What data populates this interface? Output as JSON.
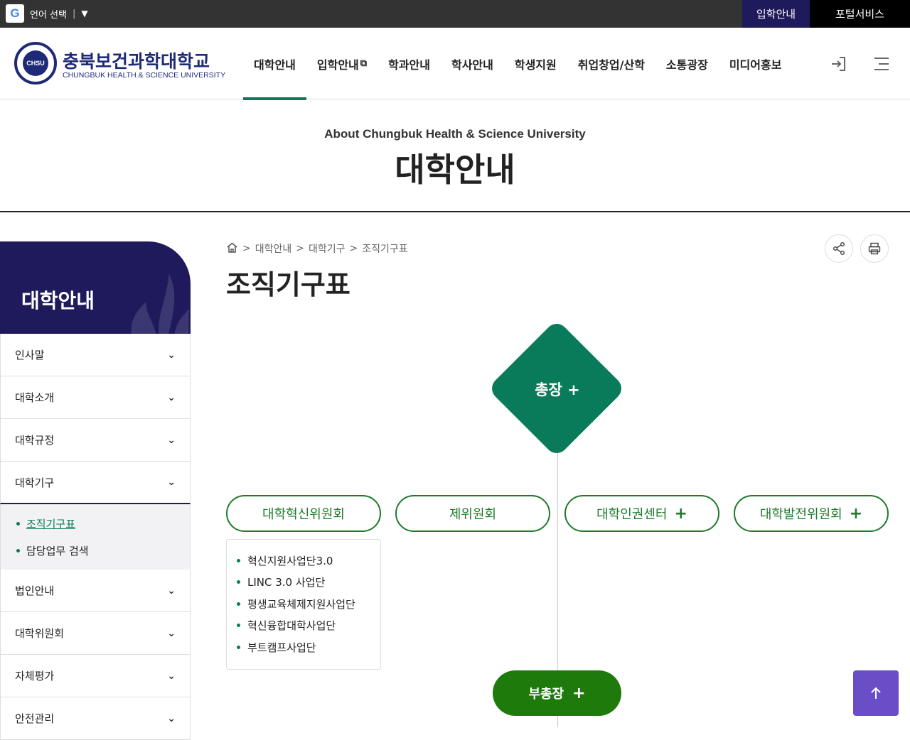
{
  "topbar": {
    "google_glyph": "G",
    "language_label": "언어 선택",
    "language_sep": "|",
    "language_arrow": "▼",
    "admission_label": "입학안내",
    "portal_label": "포털서비스"
  },
  "header": {
    "logo_ko": "충북보건과학대학교",
    "logo_en": "CHUNGBUK HEALTH & SCIENCE UNIVERSITY",
    "emblem_text": "CHSU",
    "nav": [
      {
        "label": "대학안내",
        "active": true
      },
      {
        "label": "입학안내",
        "external": true
      },
      {
        "label": "학과안내"
      },
      {
        "label": "학사안내"
      },
      {
        "label": "학생지원"
      },
      {
        "label": "취업창업/산학"
      },
      {
        "label": "소통광장"
      },
      {
        "label": "미디어홍보"
      }
    ],
    "external_glyph": "⧉",
    "login_icon": "login-icon",
    "menu_icon": "hamburger-menu-icon"
  },
  "visual": {
    "subtitle": "About Chungbuk Health & Science University",
    "title": "대학안내"
  },
  "sidebar": {
    "title": "대학안내",
    "items": [
      {
        "label": "인사말"
      },
      {
        "label": "대학소개"
      },
      {
        "label": "대학규정"
      },
      {
        "label": "대학기구",
        "open": true
      },
      {
        "label": "법인안내"
      },
      {
        "label": "대학위원회"
      },
      {
        "label": "자체평가"
      },
      {
        "label": "안전관리"
      }
    ],
    "sub_items": [
      {
        "label": "조직기구표",
        "current": true
      },
      {
        "label": "담당업무 검색"
      }
    ],
    "chevron": "⌄"
  },
  "breadcrumb": {
    "sep": ">",
    "items": [
      "대학안내",
      "대학기구",
      "조직기구표"
    ]
  },
  "page": {
    "title": "조직기구표"
  },
  "org_chart": {
    "president": "총장",
    "plus": "+",
    "nodes": [
      {
        "label": "대학혁신위원회",
        "plus": false
      },
      {
        "label": "제위원회",
        "plus": false
      },
      {
        "label": "대학인권센터",
        "plus": true
      },
      {
        "label": "대학발전위원회",
        "plus": true
      }
    ],
    "innovation_list": [
      "혁신지원사업단3.0",
      "LINC 3.0 사업단",
      "평생교육체제지원사업단",
      "혁신융합대학사업단",
      "부트캠프사업단"
    ],
    "vice_president": "부총장"
  },
  "colors": {
    "navy": "#1e1a5c",
    "green": "#0a7b5a",
    "node_green": "#1e7a2a",
    "to_top": "#6a4ec7"
  }
}
